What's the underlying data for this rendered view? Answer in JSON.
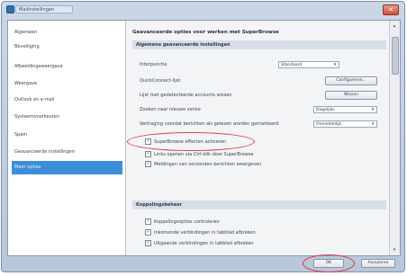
{
  "window": {
    "title": "Mailinstellingen",
    "close_glyph": "✕"
  },
  "sidebar": {
    "items": [
      {
        "label": "Algemeen"
      },
      {
        "label": "Beveiliging"
      },
      {
        "label": "Afbeeldingsweergave"
      },
      {
        "label": "Weergave"
      },
      {
        "label": "Outlook en e-mail"
      },
      {
        "label": "Systeemvoorkeuren"
      },
      {
        "label": "Spam"
      },
      {
        "label": "Geavanceerde instellingen"
      },
      {
        "label": "Meer opties",
        "selected": true
      }
    ]
  },
  "main": {
    "section_title": "Geavanceerde opties voor werken met SuperBrowse",
    "group1": {
      "header": "Algemene geavanceerde instellingen",
      "rows": [
        {
          "label": "Interpunctie",
          "control": "dropdown",
          "value": "Standaard"
        },
        {
          "label": "QuickConnect-lijst",
          "control": "button",
          "value": "Configureren..."
        },
        {
          "label": "Lijst met gedetecteerde accounts wissen",
          "control": "button",
          "value": "Wissen"
        },
        {
          "label": "Zoeken naar nieuwe versie",
          "control": "dropdown",
          "value": "Dagelijks"
        },
        {
          "label": "Vertraging voordat berichten als gelezen worden gemarkeerd",
          "control": "dropdown",
          "value": "Onmiddellijk"
        }
      ],
      "checks": [
        {
          "label": "SuperBrowse effecten activeren",
          "checked": true
        },
        {
          "label": "Links openen via Ctrl-klik door SuperBrowse",
          "checked": true
        },
        {
          "label": "Meldingen van verzonden berichten weergeven",
          "checked": true
        }
      ]
    },
    "group2": {
      "header": "Koppelingsbeheer",
      "checks": [
        {
          "label": "Koppelingsopties controleren",
          "checked": true
        },
        {
          "label": "Inkomende verbindingen in tabblad afbreken",
          "checked": true
        },
        {
          "label": "Uitgaande verbindingen in tabblad afbreken",
          "checked": true
        }
      ]
    }
  },
  "footer": {
    "ok_label": "OK",
    "cancel_label": "Annuleren"
  },
  "colors": {
    "highlight": "#d9363e",
    "selected": "#3d8ed6"
  }
}
